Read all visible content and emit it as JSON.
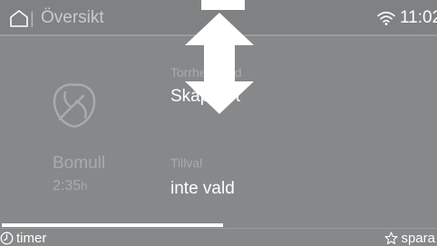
{
  "header": {
    "separator": "|",
    "title": "Översikt",
    "time": "11:02"
  },
  "program": {
    "icon": "leaf-icon",
    "name": "Bomull",
    "duration_value": "2:35",
    "duration_unit": "h"
  },
  "options": [
    {
      "label": "Torrhetsgrad",
      "value": "Skåptorrt"
    },
    {
      "label": "Tillval",
      "value": "inte vald"
    }
  ],
  "footer": {
    "timer_label": "timer",
    "save_label": "spara"
  },
  "colors": {
    "background": "#86888a",
    "header": "#7f8183",
    "text_primary": "#ffffff",
    "text_secondary": "#a9abad"
  }
}
